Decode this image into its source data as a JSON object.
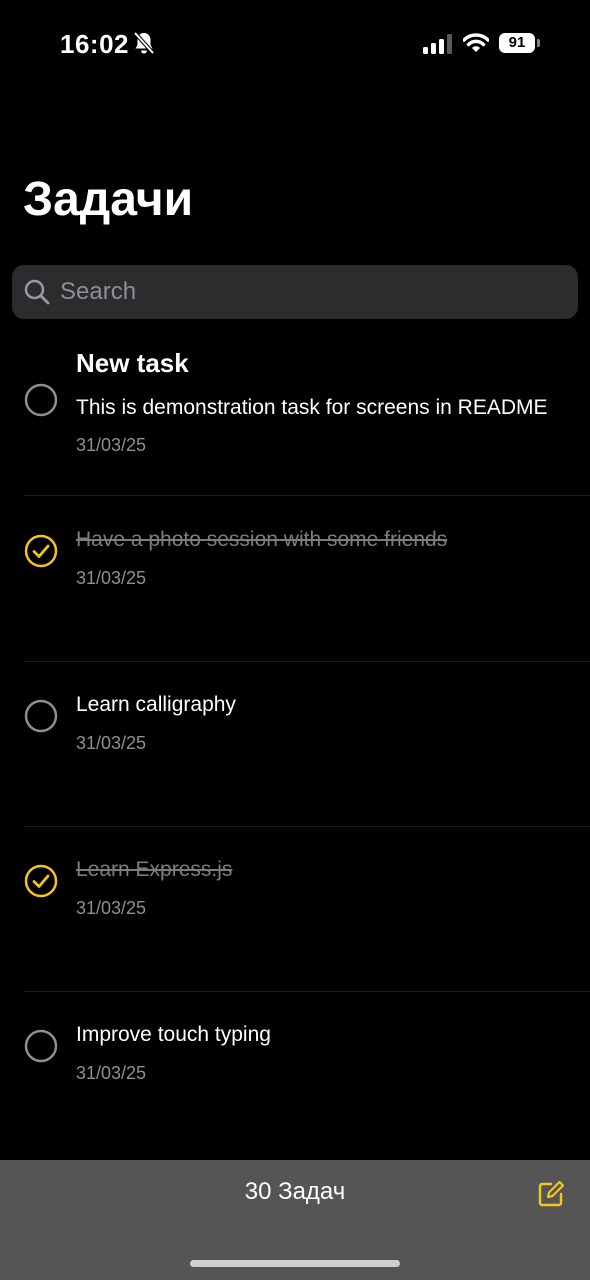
{
  "status_bar": {
    "time": "16:02",
    "battery": "91"
  },
  "title": "Задачи",
  "search": {
    "placeholder": "Search"
  },
  "tasks": [
    {
      "title": "New task",
      "text": "This is demonstration task for screens in README",
      "date": "31/03/25",
      "done": false
    },
    {
      "title": "",
      "text": "Have a photo session with some friends",
      "date": "31/03/25",
      "done": true
    },
    {
      "title": "",
      "text": "Learn calligraphy",
      "date": "31/03/25",
      "done": false
    },
    {
      "title": "",
      "text": "Learn Express.js",
      "date": "31/03/25",
      "done": true
    },
    {
      "title": "",
      "text": "Improve touch typing",
      "date": "31/03/25",
      "done": false
    }
  ],
  "toolbar": {
    "count_label": "30 Задач"
  },
  "colors": {
    "accent": "#f5c518",
    "background": "#000000",
    "toolbar": "#555555"
  }
}
